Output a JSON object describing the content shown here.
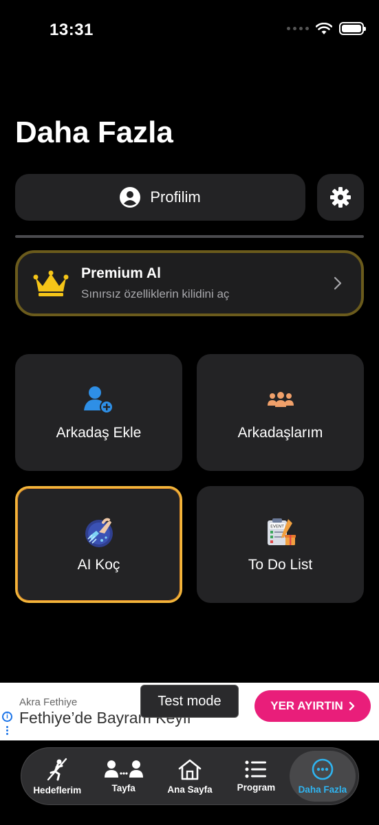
{
  "status": {
    "time": "13:31"
  },
  "page": {
    "title": "Daha Fazla"
  },
  "profile": {
    "label": "Profilim"
  },
  "premium": {
    "title": "Premium Al",
    "subtitle": "Sınırsız özelliklerin kilidini aç"
  },
  "grid": {
    "add_friend": "Arkadaş Ekle",
    "my_friends": "Arkadaşlarım",
    "ai_coach": "AI Koç",
    "todo": "To Do List"
  },
  "ad": {
    "advertiser": "Akra Fethiye",
    "headline": "Fethiye’de Bayram Keyfi",
    "cta": "YER AYIRTIN",
    "test_mode": "Test mode"
  },
  "tabs": [
    {
      "label": "Hedeflerim",
      "icon": "pole-vault-icon"
    },
    {
      "label": "Tayfa",
      "icon": "group-icon"
    },
    {
      "label": "Ana Sayfa",
      "icon": "home-icon"
    },
    {
      "label": "Program",
      "icon": "list-icon"
    },
    {
      "label": "Daha Fazla",
      "icon": "more-icon",
      "active": true
    }
  ],
  "colors": {
    "accent": "#2fb4f0",
    "premium_border": "#6b5b1c",
    "crown": "#f5c518",
    "add_friend_icon": "#2e8fe6",
    "friends_icon": "#f0a06a",
    "ai_border": "#f3b53a",
    "cta": "#e91e7a"
  }
}
